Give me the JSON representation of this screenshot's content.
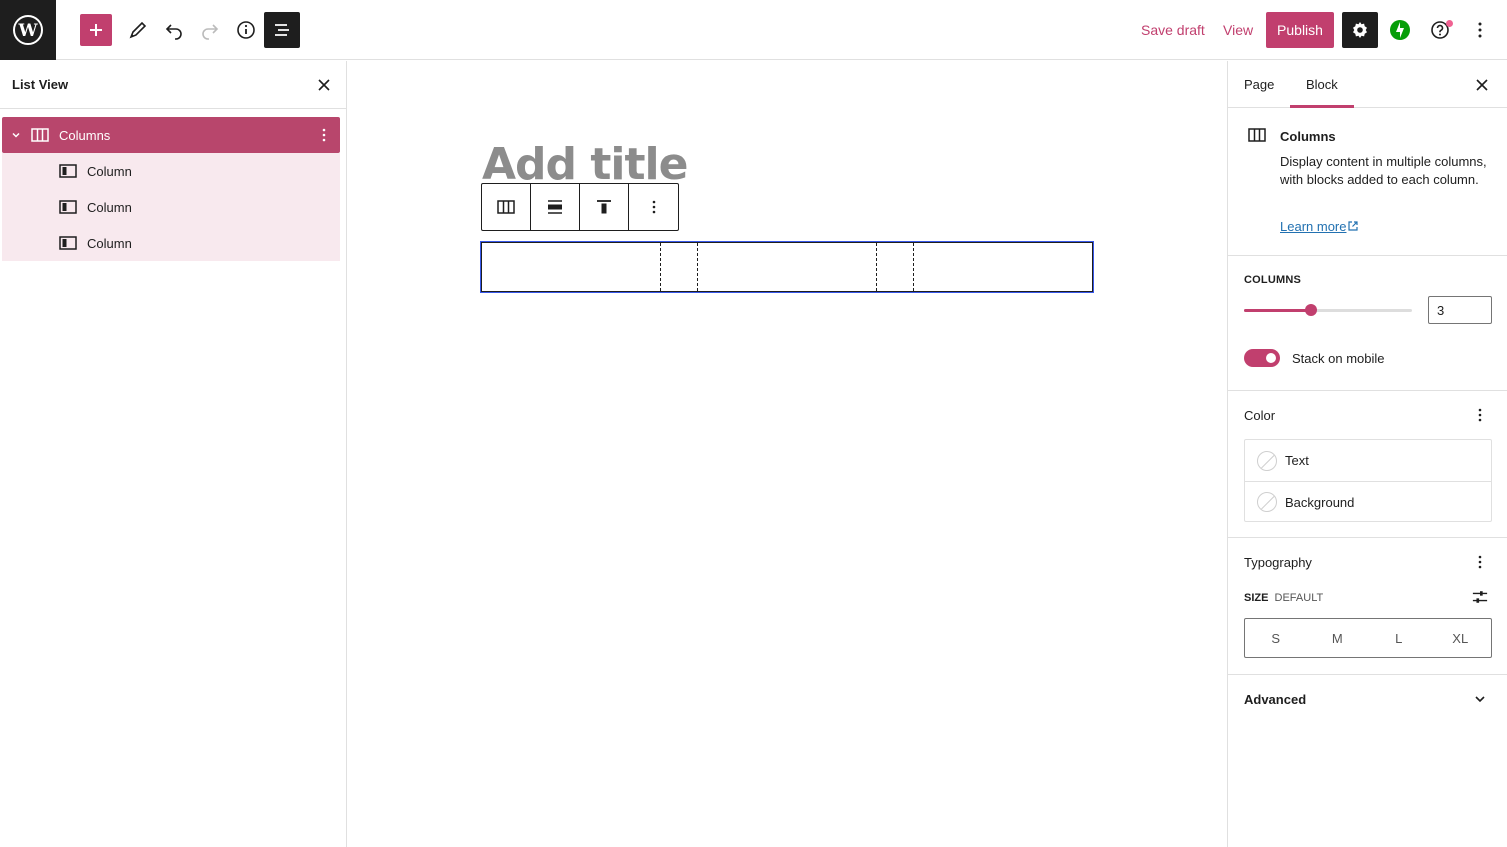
{
  "topbar": {
    "save_draft": "Save draft",
    "view": "View",
    "publish": "Publish",
    "icons": [
      "wordpress-logo",
      "plus-icon",
      "pencil-icon",
      "undo-icon",
      "redo-icon",
      "info-icon",
      "list-view-icon",
      "gear-icon",
      "jetpack-icon",
      "help-icon",
      "more-vertical-icon"
    ]
  },
  "list_view": {
    "title": "List View",
    "items": [
      {
        "label": "Columns",
        "level": 1,
        "selected": true
      },
      {
        "label": "Column",
        "level": 2
      },
      {
        "label": "Column",
        "level": 2
      },
      {
        "label": "Column",
        "level": 2
      }
    ]
  },
  "editor": {
    "title_placeholder": "Add title"
  },
  "sidebar": {
    "tabs": [
      "Page",
      "Block"
    ],
    "active_tab": "Block",
    "block_card": {
      "title": "Columns",
      "description": "Display content in multiple columns, with blocks added to each column.",
      "learn_more": "Learn more"
    },
    "columns_label": "COLUMNS",
    "columns_value": "3",
    "columns_slider_fraction": 0.4,
    "stack_label": "Stack on mobile",
    "stack_enabled": true,
    "color_title": "Color",
    "color_items": [
      "Text",
      "Background"
    ],
    "typography_title": "Typography",
    "size_label": "SIZE",
    "size_value": "DEFAULT",
    "size_options": [
      "S",
      "M",
      "L",
      "XL"
    ],
    "advanced_title": "Advanced"
  },
  "colors": {
    "accent": "#c13f6e",
    "dark": "#1e1e1e",
    "selected_row": "#b8466c",
    "child_row": "#f8e9ee",
    "link": "#2271b1"
  }
}
